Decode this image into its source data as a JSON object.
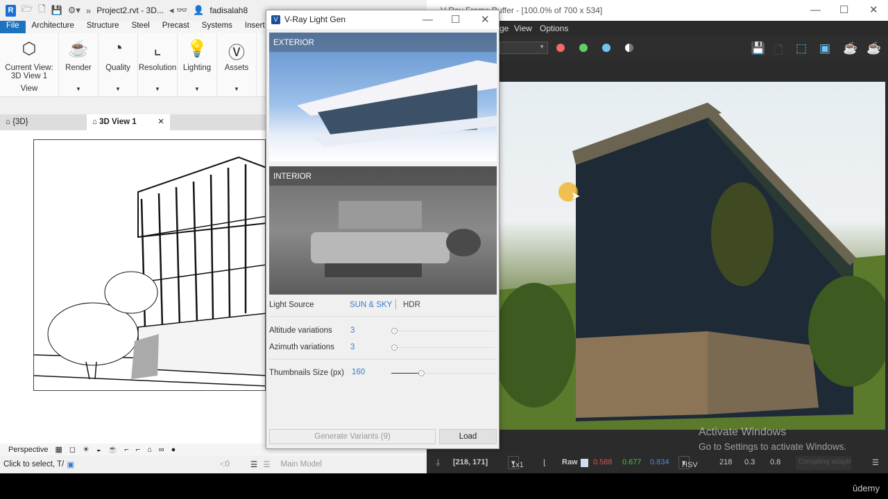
{
  "revit": {
    "title": "Project2.rvt - 3D...",
    "user": "fadisalah8",
    "tabs": [
      "File",
      "Architecture",
      "Structure",
      "Steel",
      "Precast",
      "Systems",
      "Insert"
    ],
    "ribbon": [
      {
        "label": "Current View:\n3D View 1",
        "icon": "cube-icon"
      },
      {
        "label": "Render",
        "icon": "teapot-icon"
      },
      {
        "label": "Quality",
        "icon": "quality-icon"
      },
      {
        "label": "Resolution",
        "icon": "resolution-icon"
      },
      {
        "label": "Lighting",
        "icon": "bulb-icon"
      },
      {
        "label": "Assets",
        "icon": "vray-logo-icon"
      }
    ],
    "ribbon_cur1": "Current View:",
    "ribbon_cur2": "3D View 1",
    "panel_label": "View",
    "view_tabs": [
      {
        "label": "{3D}"
      },
      {
        "label": "3D View 1"
      }
    ],
    "view_mode": "Perspective",
    "status": "Click to select, T/",
    "worksets": ":0",
    "model": "Main Model"
  },
  "vfb": {
    "title": "V-Ray Frame Buffer - [100.0% of 700 x 534]",
    "menu": [
      "ge",
      "View",
      "Options"
    ],
    "channel_colors": [
      "#f26b6b",
      "#5fd068",
      "#6ec6f5"
    ],
    "coords": "[218, 171]",
    "sample": "1x1",
    "raw": "Raw",
    "rgb": [
      "0.588",
      "0.677",
      "0.834"
    ],
    "rgb_colors": [
      "#e05050",
      "#4cc04c",
      "#4a8ed8"
    ],
    "colorspace": "HSV",
    "hsv": [
      "218",
      "0.3",
      "0.8"
    ],
    "progress": "Compiling adaptive"
  },
  "lightgen": {
    "title": "V-Ray Light Gen",
    "exterior": "EXTERIOR",
    "interior": "INTERIOR",
    "light_source_label": "Light Source",
    "sun_sky": "SUN & SKY",
    "hdr": "HDR",
    "selected_source": "SUN & SKY",
    "altitude_label": "Altitude variations",
    "altitude": "3",
    "azimuth_label": "Azimuth variations",
    "azimuth": "3",
    "thumb_label": "Thumbnails Size (px)",
    "thumb": "160",
    "generate": "Generate Variants (9)",
    "load": "Load"
  },
  "watermark": {
    "line1": "Activate Windows",
    "line2": "Go to Settings to activate Windows.",
    "brand": "ûdemy"
  }
}
